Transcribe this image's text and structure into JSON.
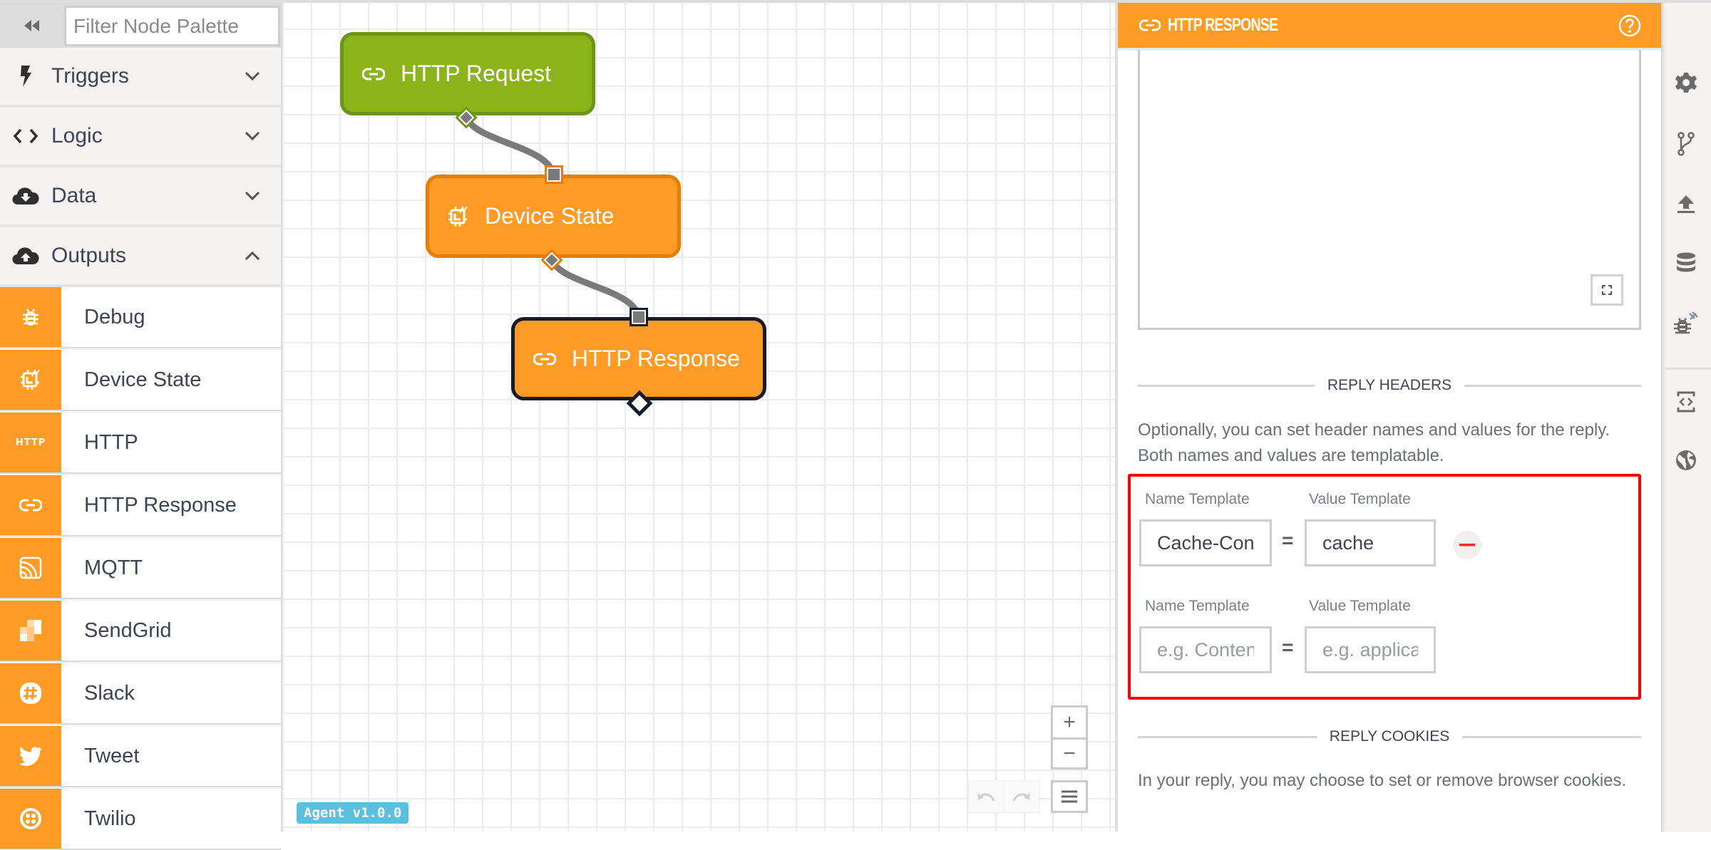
{
  "sidebar": {
    "filter_placeholder": "Filter Node Palette",
    "categories": [
      {
        "label": "Triggers",
        "icon": "lightning-icon",
        "expanded": false
      },
      {
        "label": "Logic",
        "icon": "code-brackets-icon",
        "expanded": false
      },
      {
        "label": "Data",
        "icon": "cloud-download-icon",
        "expanded": false
      },
      {
        "label": "Outputs",
        "icon": "cloud-upload-icon",
        "expanded": true
      }
    ],
    "items": [
      {
        "label": "Debug",
        "icon": "bug-icon"
      },
      {
        "label": "Device State",
        "icon": "device-state-icon"
      },
      {
        "label": "HTTP",
        "icon": "http-icon",
        "icon_text": "HTTP"
      },
      {
        "label": "HTTP Response",
        "icon": "link-icon"
      },
      {
        "label": "MQTT",
        "icon": "mqtt-icon"
      },
      {
        "label": "SendGrid",
        "icon": "sendgrid-icon"
      },
      {
        "label": "Slack",
        "icon": "slack-icon"
      },
      {
        "label": "Tweet",
        "icon": "twitter-icon"
      },
      {
        "label": "Twilio",
        "icon": "twilio-icon"
      }
    ]
  },
  "canvas": {
    "nodes": [
      {
        "label": "HTTP Request",
        "icon": "link-icon",
        "color": "#8db31b"
      },
      {
        "label": "Device State",
        "icon": "device-state-icon",
        "color": "#ff9b27"
      },
      {
        "label": "HTTP Response",
        "icon": "link-icon",
        "color": "#ff9b27",
        "selected": true
      }
    ],
    "zoom_in_label": "+",
    "zoom_out_label": "−",
    "agent_version": "Agent v1.0.0"
  },
  "panel": {
    "title": "HTTP RESPONSE",
    "accent_color": "#ff9c26",
    "reply_headers": {
      "section_title": "REPLY HEADERS",
      "description": "Optionally, you can set header names and values for the reply. Both names and values are templatable.",
      "rows": [
        {
          "name_label": "Name Template",
          "value_label": "Value Template",
          "name_value": "Cache-Control",
          "value_value": "cache",
          "name_placeholder": "",
          "value_placeholder": "",
          "removable": true
        },
        {
          "name_label": "Name Template",
          "value_label": "Value Template",
          "name_value": "",
          "value_value": "",
          "name_placeholder": "e.g. Content-Type",
          "value_placeholder": "e.g. application/json",
          "removable": false
        }
      ],
      "equals": "="
    },
    "reply_cookies": {
      "section_title": "REPLY COOKIES",
      "description": "In your reply, you may choose to set or remove browser cookies."
    }
  },
  "iconbar": {
    "items": [
      "gear-icon",
      "branch-icon",
      "upload-icon",
      "database-icon",
      "debug-disconnected-icon",
      "code-icon",
      "globe-icon"
    ]
  }
}
